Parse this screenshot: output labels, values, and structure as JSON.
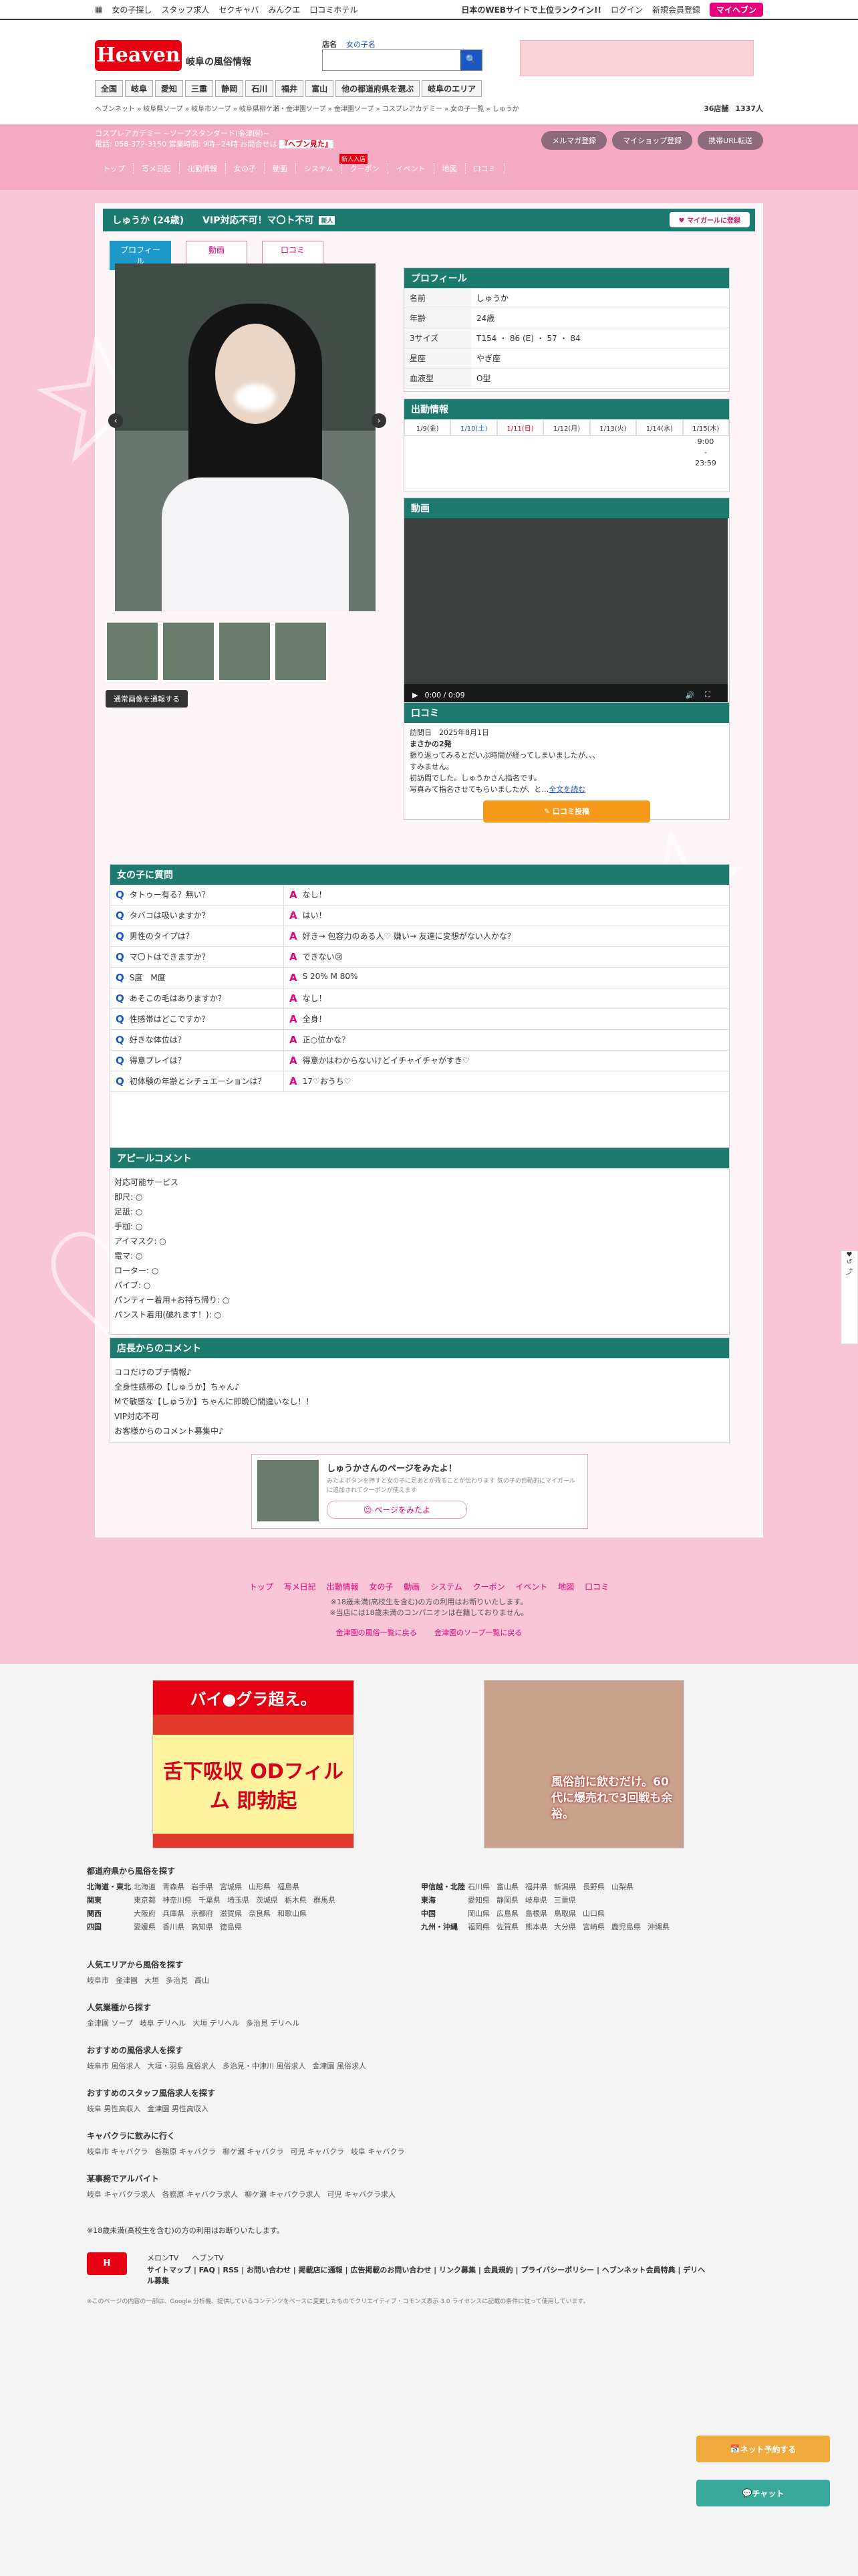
{
  "topbar": {
    "left": [
      "女の子探し",
      "スタッフ求人",
      "セクキャバ",
      "みんクエ",
      "口コミホテル"
    ],
    "notice": "日本のWEBサイトで上位ランクイン!!",
    "login": "ログイン",
    "register": "新規会員登録",
    "brand": "マイヘブン"
  },
  "header": {
    "logo": "Heaven",
    "region": "岐阜の風俗情報",
    "search_label": "店名",
    "search_placeholder": "女の子名",
    "nav": [
      "全国",
      "岐阜",
      "愛知",
      "三重",
      "静岡",
      "石川",
      "福井",
      "富山",
      "他の都道府県を選ぶ",
      "岐阜のエリア"
    ],
    "breadcrumb": "ヘブンネット » 岐阜県ソープ » 岐阜市ソープ » 岐阜県柳ケ瀬・金津園ソープ » 金津園ソープ » コスプレアカデミー » 女の子一覧 » しゅうか",
    "count1": "36店舗",
    "count2": "1337人"
  },
  "shop": {
    "name": "コスプレアカデミー ~ソープスタンダード(金津園)~",
    "phone": "電話: 058-372-3150 営業時間: 9時~24時 お問合せは",
    "call_note": "『ヘブン見た』",
    "buttons": [
      "メルマガ登録",
      "マイショップ登録",
      "携帯URL転送"
    ],
    "nav": [
      "トップ",
      "写メ日記",
      "出勤情報",
      "女の子",
      "動画",
      "システム",
      "クーポン",
      "イベント",
      "地図",
      "口コミ"
    ],
    "new_badge": "新人入店"
  },
  "girl": {
    "title": "しゅうか (24歳)　　VIP対応不可！マ〇ト不可",
    "title_badge": "新人",
    "fav": "マイガールに登録",
    "tabs": [
      "プロフィール",
      "動画",
      "口コミ"
    ],
    "photo_request": "通常画像を通報する"
  },
  "profile": {
    "heading": "プロフィール",
    "rows": [
      {
        "k": "名前",
        "v": "しゅうか"
      },
      {
        "k": "年齢",
        "v": "24歳"
      },
      {
        "k": "3サイズ",
        "v": "T154 ・ 86 (E) ・ 57 ・ 84"
      },
      {
        "k": "星座",
        "v": "やぎ座"
      },
      {
        "k": "血液型",
        "v": "O型"
      }
    ]
  },
  "schedule": {
    "heading": "出勤情報",
    "days": [
      "1/9(金)",
      "1/10(土)",
      "1/11(日)",
      "1/12(月)",
      "1/13(火)",
      "1/14(水)",
      "1/15(木)"
    ],
    "time_start": "9:00",
    "time_sep": "-",
    "time_end": "23:59"
  },
  "video": {
    "heading": "動画",
    "time": "0:00 / 0:09"
  },
  "review": {
    "heading": "口コミ",
    "date_label": "訪問日",
    "date": "2025年8月1日",
    "title": "まさかの2発",
    "body1": "振り返ってみるとだいぶ時間が経ってしまいましたが、、、",
    "body2": "すみません。",
    "body3": "初訪問でした。しゅうかさん指名です。",
    "body4": "写真みて指名させてもらいましたが、と…",
    "more": "全文を読む",
    "post": "口コミ投稿"
  },
  "qa": {
    "heading": "女の子に質問",
    "rows": [
      {
        "q": "タトゥー有る？無い？",
        "a": "なし！"
      },
      {
        "q": "タバコは吸いますか？",
        "a": "はい！"
      },
      {
        "q": "男性のタイプは？",
        "a": "好き→ 包容力のある人♡ 嫌い→ 友達に変想がない人かな？"
      },
      {
        "q": "マ〇トはできますか？",
        "a": "できない😢"
      },
      {
        "q": "S度　M度",
        "a": "S 20% M 80%"
      },
      {
        "q": "あそこの毛はありますか？",
        "a": "なし！"
      },
      {
        "q": "性感帯はどこですか？",
        "a": "全身！"
      },
      {
        "q": "好きな体位は？",
        "a": "正○位かな？"
      },
      {
        "q": "得意プレイは？",
        "a": "得意かはわからないけどイチャイチャがすき♡"
      },
      {
        "q": "初体験の年齢とシチュエーションは？",
        "a": "17♡おうち♡"
      }
    ]
  },
  "appeal": {
    "heading": "アピールコメント",
    "lines": [
      "対応可能サービス",
      "即尺: ○",
      "足舐: ○",
      "手枷: ○",
      "アイマスク: ○",
      "電マ: ○",
      "ローター: ○",
      "バイブ: ○",
      "パンティー着用+お持ち帰り: ○",
      "パンスト着用(破れます！): ○"
    ]
  },
  "staff": {
    "heading": "店長からのコメント",
    "lines": [
      "ココだけのプチ情報♪",
      "全身性感帯の【しゅうか】ちゃん♪",
      "Mで敏感な【しゅうか】ちゃんに即晩〇間違いなし！！",
      "VIP対応不可",
      "お客様からのコメント募集中♪"
    ]
  },
  "share": {
    "title": "しゅうかさんのページをみたよ！",
    "desc": "みたよボタンを押すと女の子に足あとが残ることが伝わります 気の子の自動的にマイガールに追加されてクーポンが使えます",
    "btn": "ページをみたよ"
  },
  "footer": {
    "nav": [
      "トップ",
      "写メ日記",
      "出勤情報",
      "女の子",
      "動画",
      "システム",
      "クーポン",
      "イベント",
      "地図",
      "口コミ"
    ],
    "notice": "※18歳未満(高校生を含む)の方の利用はお断りいたします。",
    "notice2": "※当店には18歳未満のコンパニオンは在籍しておりません。",
    "back1": "金津園の風俗一覧に戻る",
    "back2": "金津園のソープ一覧に戻る",
    "ad1": "舌下吸収 ODフィルム 即勃起",
    "ad1_top": "バイ●グラ超え。",
    "ad2": "風俗前に飲むだけ。60代に爆売れで3回戦も余裕。",
    "pref_heading": "都道府県から風俗を探す",
    "regions": [
      {
        "r": "北海道・東北",
        "p": [
          "北海道",
          "青森県",
          "岩手県",
          "宮城県",
          "山形県",
          "福島県"
        ]
      },
      {
        "r": "関東",
        "p": [
          "東京都",
          "神奈川県",
          "千葉県",
          "埼玉県",
          "茨城県",
          "栃木県",
          "群馬県"
        ]
      },
      {
        "r": "関西",
        "p": [
          "大阪府",
          "兵庫県",
          "京都府",
          "滋賀県",
          "奈良県",
          "和歌山県"
        ]
      },
      {
        "r": "四国",
        "p": [
          "愛媛県",
          "香川県",
          "高知県",
          "徳島県"
        ]
      }
    ],
    "regions2": [
      {
        "r": "甲信越・北陸",
        "p": [
          "石川県",
          "富山県",
          "福井県",
          "新潟県",
          "長野県",
          "山梨県"
        ]
      },
      {
        "r": "東海",
        "p": [
          "愛知県",
          "静岡県",
          "岐阜県",
          "三重県"
        ]
      },
      {
        "r": "中国",
        "p": [
          "岡山県",
          "広島県",
          "島根県",
          "鳥取県",
          "山口県"
        ]
      },
      {
        "r": "九州・沖縄",
        "p": [
          "福岡県",
          "佐賀県",
          "熊本県",
          "大分県",
          "宮崎県",
          "鹿児島県",
          "沖縄県"
        ]
      }
    ],
    "pop_area_h": "人気エリアから風俗を探す",
    "pop_area": [
      "岐阜市",
      "金津園",
      "大垣",
      "多治見",
      "高山"
    ],
    "pop_kind_h": "人気業種から探す",
    "pop_kind": [
      "金津園 ソープ",
      "岐阜 デリヘル",
      "大垣 デリヘル",
      "多治見 デリヘル"
    ],
    "rec_h": "おすすめの風俗求人を探す",
    "rec": [
      "岐阜市 風俗求人",
      "大垣・羽島 風俗求人",
      "多治見・中津川 風俗求人",
      "金津園 風俗求人"
    ],
    "staff_h": "おすすめのスタッフ風俗求人を探す",
    "staff": [
      "岐阜 男性高収入",
      "金津園 男性高収入"
    ],
    "kyaba_h": "キャバクラに飲みに行く",
    "kyaba": [
      "岐阜市 キャバクラ",
      "各務原 キャバクラ",
      "柳ケ瀬 キャバクラ",
      "可児 キャバクラ",
      "岐阜 キャバクラ"
    ],
    "job_h": "某事務でアルバイト",
    "job": [
      "岐阜 キャバクラ求人",
      "各務原 キャバクラ求人",
      "柳ケ瀬 キャバクラ求人",
      "可児 キャバクラ求人"
    ],
    "age_notice": "※18歳未満(高校生を含む)の方の利用はお断りいたします。",
    "bottom_links": "サイトマップ | FAQ | RSS | お問い合わせ | 掲載店に通報 | 広告掲載のお問い合わせ | リンク募集 | 会員規約 | プライバシーポリシー | ヘブンネット会員特典 | デリヘル募集",
    "sns1": "メロンTV",
    "sns2": "ヘブンTV",
    "copyright": "※このページの内容の一部は、Google 分析機、提供しているコンテンツをベースに変更したものでクリエイティブ・コモンズ表示 3.0 ライセンスに記載の条件に従って使用しています。",
    "fixed1": "ネット予約する",
    "fixed2": "チャット"
  }
}
